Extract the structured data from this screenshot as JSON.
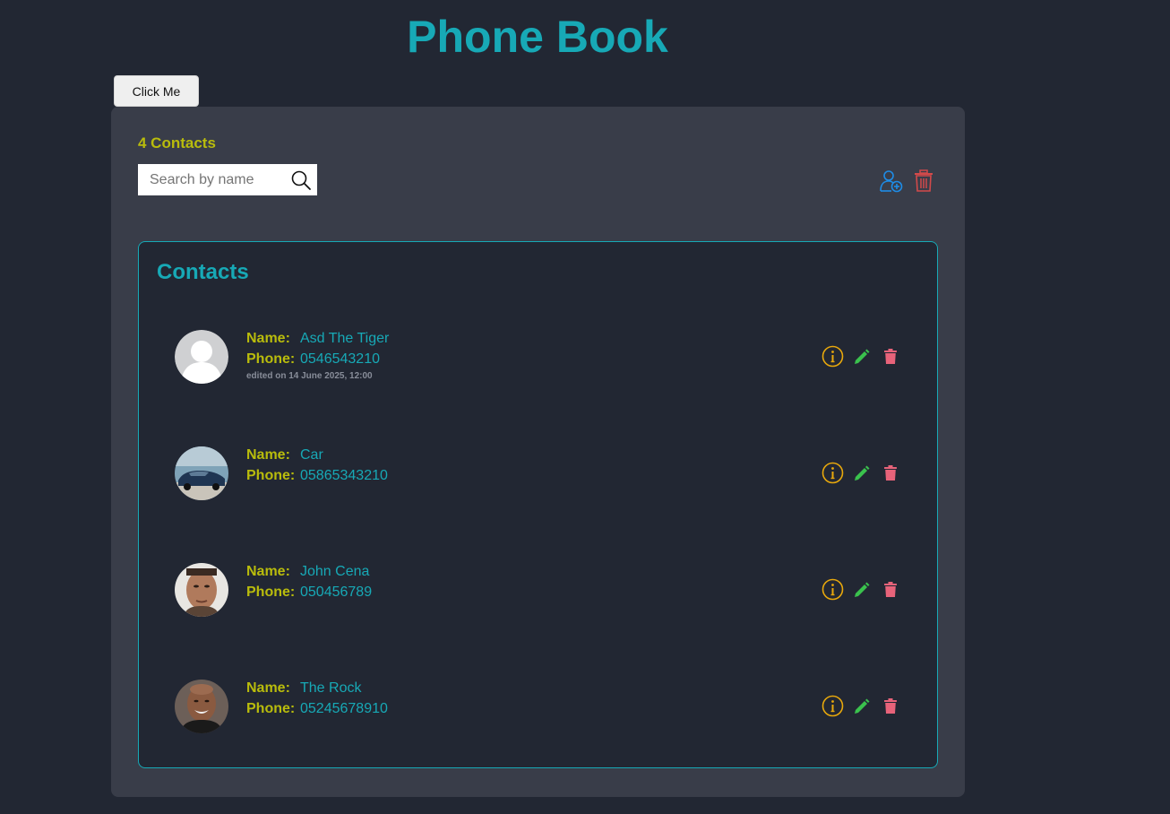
{
  "header": {
    "title": "Phone Book",
    "click_button": "Click Me"
  },
  "toolbar": {
    "count_label": "4 Contacts",
    "search_placeholder": "Search by name",
    "search_icon": "search-icon",
    "add_icon": "add-contact-icon",
    "delete_all_icon": "trash-icon"
  },
  "contacts_section": {
    "title": "Contacts",
    "name_label": "Name:",
    "phone_label": "Phone:",
    "items": [
      {
        "name": "Asd The Tiger",
        "phone": "0546543210",
        "edited": "edited on 14 June 2025, 12:00",
        "avatar": "default-avatar"
      },
      {
        "name": "Car",
        "phone": "05865343210",
        "edited": "",
        "avatar": "car-photo"
      },
      {
        "name": "John Cena",
        "phone": "050456789",
        "edited": "",
        "avatar": "person-photo"
      },
      {
        "name": "The Rock",
        "phone": "05245678910",
        "edited": "",
        "avatar": "person-photo"
      }
    ]
  },
  "colors": {
    "background": "#222733",
    "panel": "#393d49",
    "accent_teal": "#17a9b6",
    "label_yellow": "#b9bc0c",
    "info_orange": "#e8a80c",
    "edit_green": "#3ac24d",
    "delete_red": "#e8637a",
    "add_blue": "#1e8ce6"
  }
}
